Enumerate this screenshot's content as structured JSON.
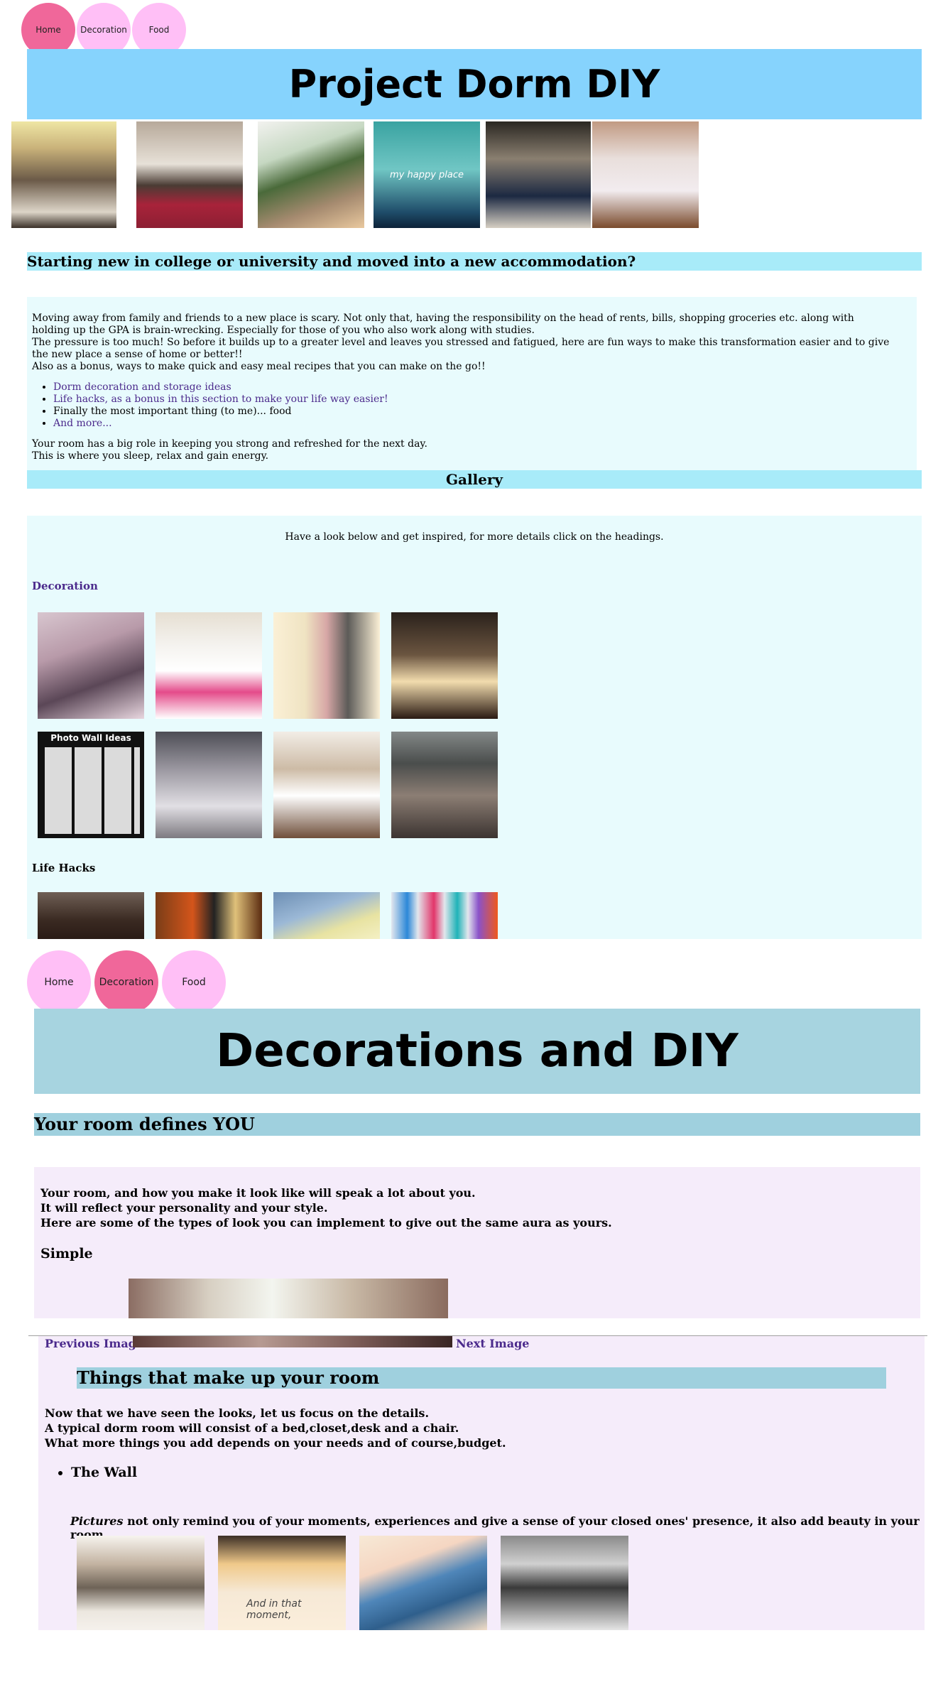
{
  "page1": {
    "nav": [
      {
        "label": "Home",
        "active": true
      },
      {
        "label": "Decoration",
        "active": false
      },
      {
        "label": "Food",
        "active": false
      }
    ],
    "title": "Project Dorm DIY",
    "hero_photo_caption": "my happy place",
    "question_heading": "Starting new in college or university and moved into a new accommodation?",
    "intro": {
      "p1": "Moving away from family and friends to a new place is scary. Not only that, having the responsibility on the head of rents, bills, shopping groceries etc. along with holding up the GPA is brain-wrecking. Especially for those of you who also work along with studies.",
      "p2": "The pressure is too much! So before it builds up to a greater level and leaves you stressed and fatigued, here are fun ways to make this transformation easier and to give the new place a sense of home or better!!",
      "p3": "Also as a bonus, ways to make quick and easy meal recipes that you can make on the go!!",
      "list": [
        "Dorm decoration and storage ideas",
        "Life hacks, as a bonus in this section to make your life way easier!",
        "Finally the most important thing (to me)... food",
        "And more..."
      ],
      "closing1": "Your room has a big role in keeping you strong and refreshed for the next day.",
      "closing2": "This is where you sleep, relax and gain energy."
    },
    "gallery_heading": "Gallery",
    "gallery_intro": "Have a look below and get inspired, for more details click on the headings.",
    "decoration_heading": "Decoration",
    "photo_wall_caption": "Photo Wall Ideas",
    "life_hacks_heading": "Life Hacks"
  },
  "page2": {
    "nav": [
      {
        "label": "Home",
        "active": false
      },
      {
        "label": "Decoration",
        "active": true
      },
      {
        "label": "Food",
        "active": false
      }
    ],
    "title": "Decorations and DIY",
    "room_heading": "Your room defines YOU",
    "room_text": [
      "Your room, and how you make it look like will speak a lot about you.",
      "It will reflect your personality and your style.",
      "Here are some of the types of look you can implement to give out the same aura as yours."
    ],
    "simple_heading": "Simple",
    "prev_label": "Previous Image",
    "next_label": "Next Image",
    "things_heading": "Things that make up your room",
    "things_text": [
      "Now that we have seen the looks, let us focus on the details.",
      "A typical dorm room will consist of a bed,closet,desk and a chair.",
      "What more things you add depends on your needs and of course,budget."
    ],
    "wall_item": "The Wall",
    "pictures_em": "Pictures",
    "pictures_text": " not only remind you of your moments, experiences and give a sense of your closed ones' presence, it also add beauty in your room.",
    "wall_photo_caption": "And in that moment,"
  }
}
